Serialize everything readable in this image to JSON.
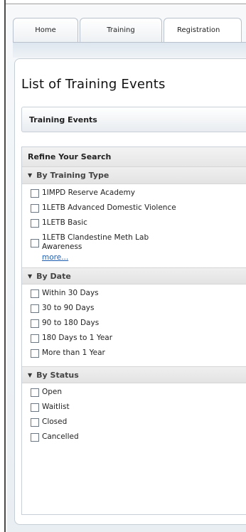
{
  "tabs": [
    {
      "label": "Home"
    },
    {
      "label": "Training"
    },
    {
      "label": "Registration"
    }
  ],
  "page": {
    "title": "List of Training Events",
    "section_title": "Training Events"
  },
  "refine": {
    "title": "Refine Your Search",
    "groups": [
      {
        "title": "By Training Type",
        "options": [
          "1IMPD Reserve Academy",
          "1LETB Advanced Domestic Violence",
          "1LETB Basic",
          "1LETB Clandestine Meth Lab Awareness"
        ],
        "more_label": "more..."
      },
      {
        "title": "By Date",
        "options": [
          "Within 30 Days",
          "30 to 90 Days",
          "90 to 180 Days",
          "180 Days to 1 Year",
          "More than 1 Year"
        ]
      },
      {
        "title": "By Status",
        "options": [
          "Open",
          "Waitlist",
          "Closed",
          "Cancelled"
        ]
      }
    ]
  },
  "colors": {
    "link": "#1f5fb2",
    "panel_border": "#c9cfd6"
  }
}
